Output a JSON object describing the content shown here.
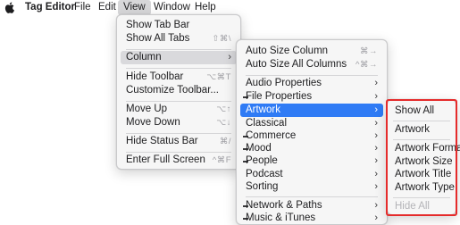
{
  "menubar": {
    "app_name": "Tag Editor",
    "items": [
      "File",
      "Edit",
      "View",
      "Window",
      "Help"
    ]
  },
  "view_menu": {
    "show_tab_bar": "Show Tab Bar",
    "show_all_tabs": {
      "label": "Show All Tabs",
      "shortcut": "⇧⌘\\"
    },
    "column": "Column",
    "hide_toolbar": {
      "label": "Hide Toolbar",
      "shortcut": "⌥⌘T"
    },
    "customize_toolbar": "Customize Toolbar...",
    "move_up": {
      "label": "Move Up",
      "shortcut": "⌥↑"
    },
    "move_down": {
      "label": "Move Down",
      "shortcut": "⌥↓"
    },
    "hide_status_bar": {
      "label": "Hide Status Bar",
      "shortcut": "⌘/"
    },
    "enter_full_screen": {
      "label": "Enter Full Screen",
      "shortcut": "^⌘F"
    }
  },
  "column_menu": {
    "auto_size_column": {
      "label": "Auto Size Column",
      "shortcut": "⌘→"
    },
    "auto_size_all_columns": {
      "label": "Auto Size All Columns",
      "shortcut": "^⌘→"
    },
    "audio_properties": "Audio Properties",
    "file_properties": "File Properties",
    "artwork": "Artwork",
    "classical": "Classical",
    "commerce": "Commerce",
    "mood": "Mood",
    "people": "People",
    "podcast": "Podcast",
    "sorting": "Sorting",
    "network_paths": "Network & Paths",
    "music_itunes": "Music & iTunes"
  },
  "artwork_menu": {
    "show_all": "Show All",
    "artwork": "Artwork",
    "artwork_format": "Artwork Format",
    "artwork_size": "Artwork Size",
    "artwork_title": "Artwork Title",
    "artwork_type": "Artwork Type",
    "hide_all": "Hide All"
  },
  "colors": {
    "selection": "#2f7bf5",
    "highlight_frame": "#e52b2b"
  }
}
